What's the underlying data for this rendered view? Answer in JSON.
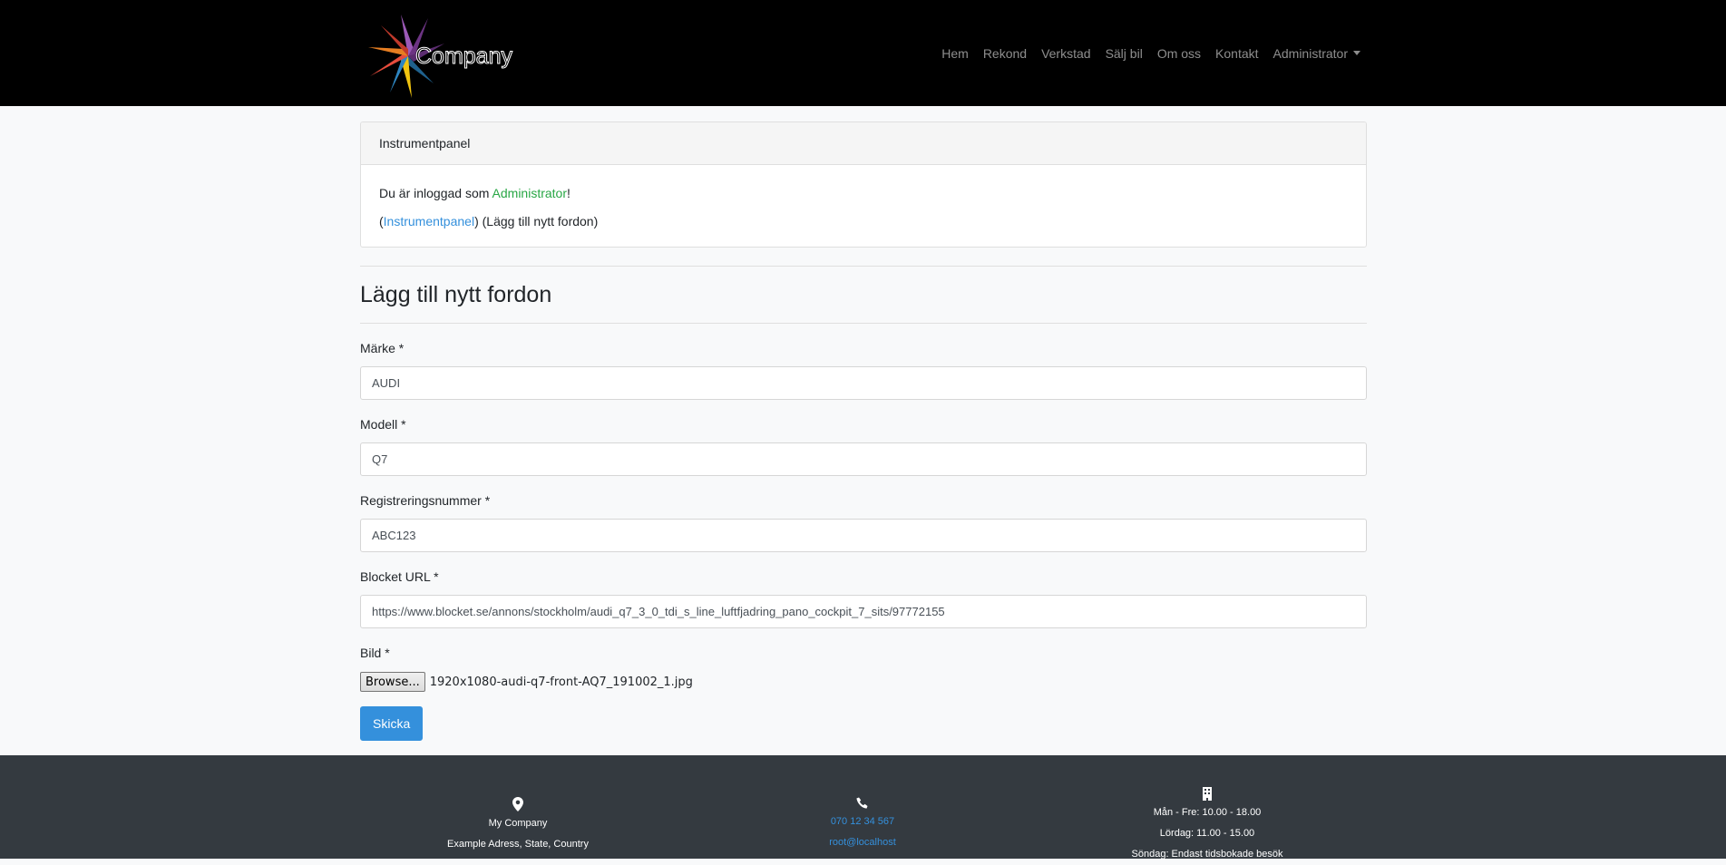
{
  "brand": {
    "name": "Company"
  },
  "nav": {
    "items": [
      "Hem",
      "Rekond",
      "Verkstad",
      "Sälj bil",
      "Om oss",
      "Kontakt"
    ],
    "dropdown_label": "Administrator"
  },
  "dashboard": {
    "header": "Instrumentpanel",
    "logged_in_prefix": "Du är inloggad som ",
    "role": "Administrator",
    "logged_in_suffix": "!",
    "crumb_open": "(",
    "crumb_link": "Instrumentpanel",
    "crumb_rest": ") (Lägg till nytt fordon)"
  },
  "form": {
    "title": "Lägg till nytt fordon",
    "fields": [
      {
        "label": "Märke *",
        "value": "AUDI"
      },
      {
        "label": "Modell *",
        "value": "Q7"
      },
      {
        "label": "Registreringsnummer *",
        "value": "ABC123"
      },
      {
        "label": "Blocket URL *",
        "value": "https://www.blocket.se/annons/stockholm/audi_q7_3_0_tdi_s_line_luftfjadring_pano_cockpit_7_sits/97772155"
      }
    ],
    "image_label": "Bild *",
    "browse_label": "Browse...",
    "file_name": "1920x1080-audi-q7-front-AQ7_191002_1.jpg",
    "submit_label": "Skicka"
  },
  "footer": {
    "address": {
      "icon": "map-pin-icon",
      "name": "My Company",
      "line": "Example Adress, State, Country"
    },
    "contact": {
      "icon": "phone-icon",
      "phone": "070 12 34 567",
      "email": "root@localhost"
    },
    "hours": {
      "icon": "building-icon",
      "weekdays": "Mån - Fre: 10.00 - 18.00",
      "saturday": "Lördag: 11.00 - 15.00",
      "sunday": "Söndag: Endast tidsbokade besök"
    }
  },
  "colors": {
    "navbar": "#000000",
    "footer": "#343a40",
    "accent": "#3490dc",
    "success": "#28a745"
  }
}
